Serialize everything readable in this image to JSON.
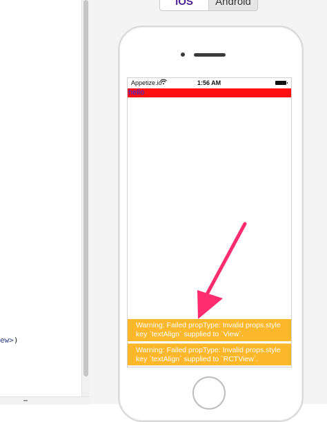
{
  "editor": {
    "code_fragment": "ew>",
    "code_paren": ")"
  },
  "preview": {
    "tabs": [
      {
        "label": "iOS",
        "active": true
      },
      {
        "label": "Android",
        "active": false
      }
    ]
  },
  "status_bar": {
    "carrier": "Appetize.io",
    "time": "1:56 AM"
  },
  "app": {
    "hello_text": "hello",
    "hello_background": "#ff1010",
    "hello_color": "#2b2bd6"
  },
  "warnings": [
    {
      "line1": "Warning: Failed propType: Invalid props.style",
      "line2": "key `textAlign` supplied to `View`."
    },
    {
      "line1": "Warning: Failed propType: Invalid props.style",
      "line2": "key `textAlign` supplied to `RCTView`."
    }
  ],
  "colors": {
    "warning_background": "#fcb72a",
    "arrow": "#ff2d6f",
    "active_tab_text": "#4a1d96"
  }
}
